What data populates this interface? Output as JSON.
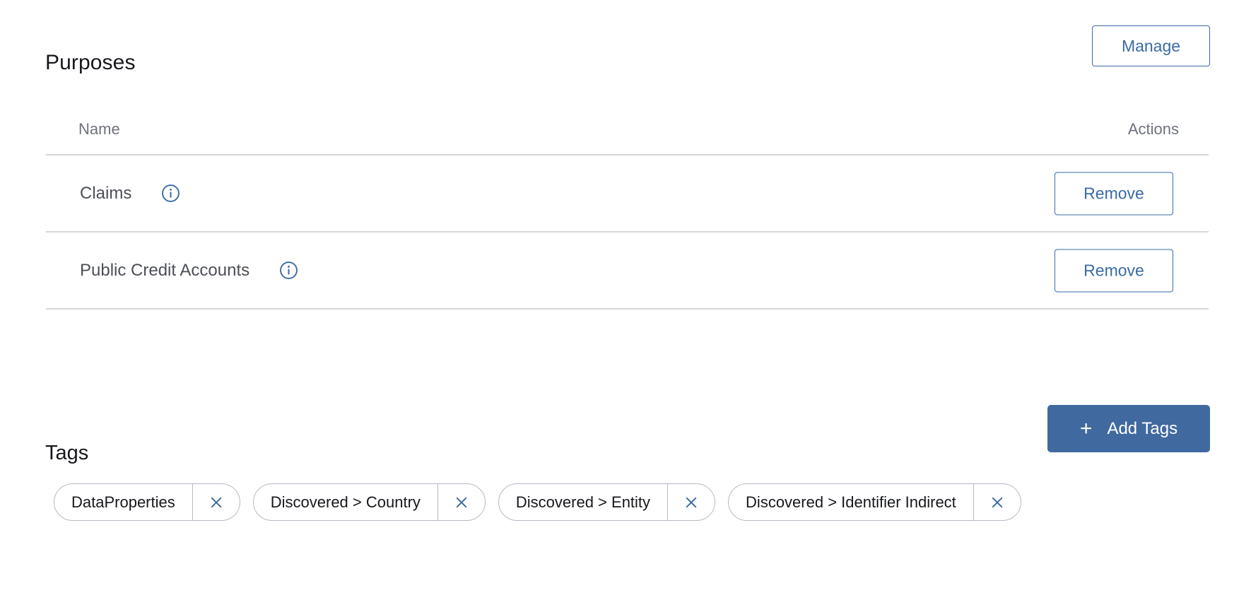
{
  "colors": {
    "accent_blue": "#3a6ba5",
    "button_fill_blue": "#40699f",
    "divider_gray": "#d5d7dd",
    "header_text_gray": "#6f727e",
    "body_text": "#4c4f57",
    "title_text": "#16181d",
    "chip_border": "#b7bac4"
  },
  "purposes": {
    "title": "Purposes",
    "manage_button": "Manage",
    "manage_icon": "none",
    "columns": {
      "name": "Name",
      "actions": "Actions"
    },
    "rows": [
      {
        "name": "Claims",
        "info_icon": "info-circle-icon",
        "action_label": "Remove"
      },
      {
        "name": "Public Credit Accounts",
        "info_icon": "info-circle-icon",
        "action_label": "Remove"
      }
    ]
  },
  "tags": {
    "title": "Tags",
    "add_button": {
      "label": "Add Tags",
      "icon": "plus-icon",
      "icon_glyph": "+"
    },
    "chips": [
      {
        "label": "DataProperties",
        "remove_icon": "close-x-icon"
      },
      {
        "label": "Discovered > Country",
        "remove_icon": "close-x-icon"
      },
      {
        "label": "Discovered > Entity",
        "remove_icon": "close-x-icon"
      },
      {
        "label": "Discovered > Identifier Indirect",
        "remove_icon": "close-x-icon"
      }
    ]
  }
}
